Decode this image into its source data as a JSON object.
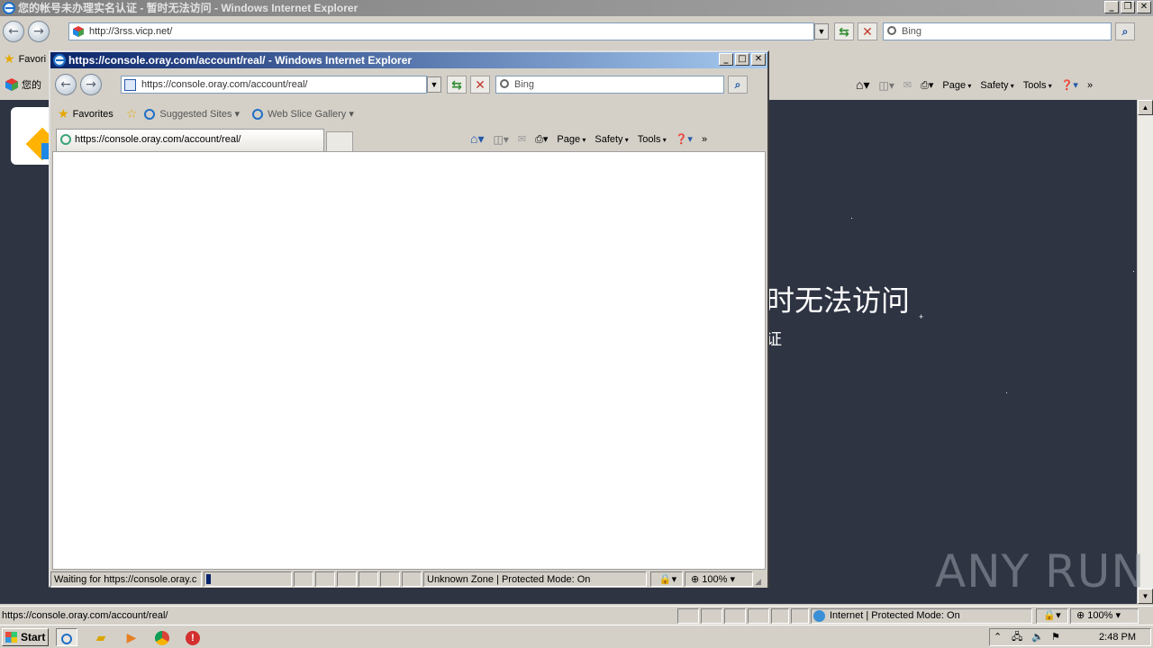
{
  "bg_window": {
    "title": "您的帐号未办理实名认证 - 暂时无法访问 - Windows Internet Explorer",
    "address": "http://3rss.vicp.net/",
    "search_placeholder": "Bing",
    "favorites_label": "Favori",
    "tab_label": "您的",
    "commands": {
      "page": "Page",
      "safety": "Safety",
      "tools": "Tools"
    },
    "heading_fragment": "时无法访问",
    "subheading_fragment": "证",
    "status_url": "https://console.oray.com/account/real/",
    "zone": "Internet | Protected Mode: On",
    "zoom": "100%"
  },
  "fg_window": {
    "title": "https://console.oray.com/account/real/ - Windows Internet Explorer",
    "address": "https://console.oray.com/account/real/",
    "search_placeholder": "Bing",
    "favorites_label": "Favorites",
    "suggested_sites": "Suggested Sites",
    "web_slice_gallery": "Web Slice Gallery",
    "tab_label": "https://console.oray.com/account/real/",
    "commands": {
      "page": "Page",
      "safety": "Safety",
      "tools": "Tools"
    },
    "status_text": "Waiting for https://console.oray.c",
    "zone": "Unknown Zone | Protected Mode: On",
    "zoom": "100%"
  },
  "taskbar": {
    "start_label": "Start",
    "clock": "2:48 PM"
  },
  "watermark": "ANY RUN",
  "colors": {
    "bg_page": "#2f3443",
    "title_active": "#0a246a",
    "chrome": "#d4d0c8"
  }
}
